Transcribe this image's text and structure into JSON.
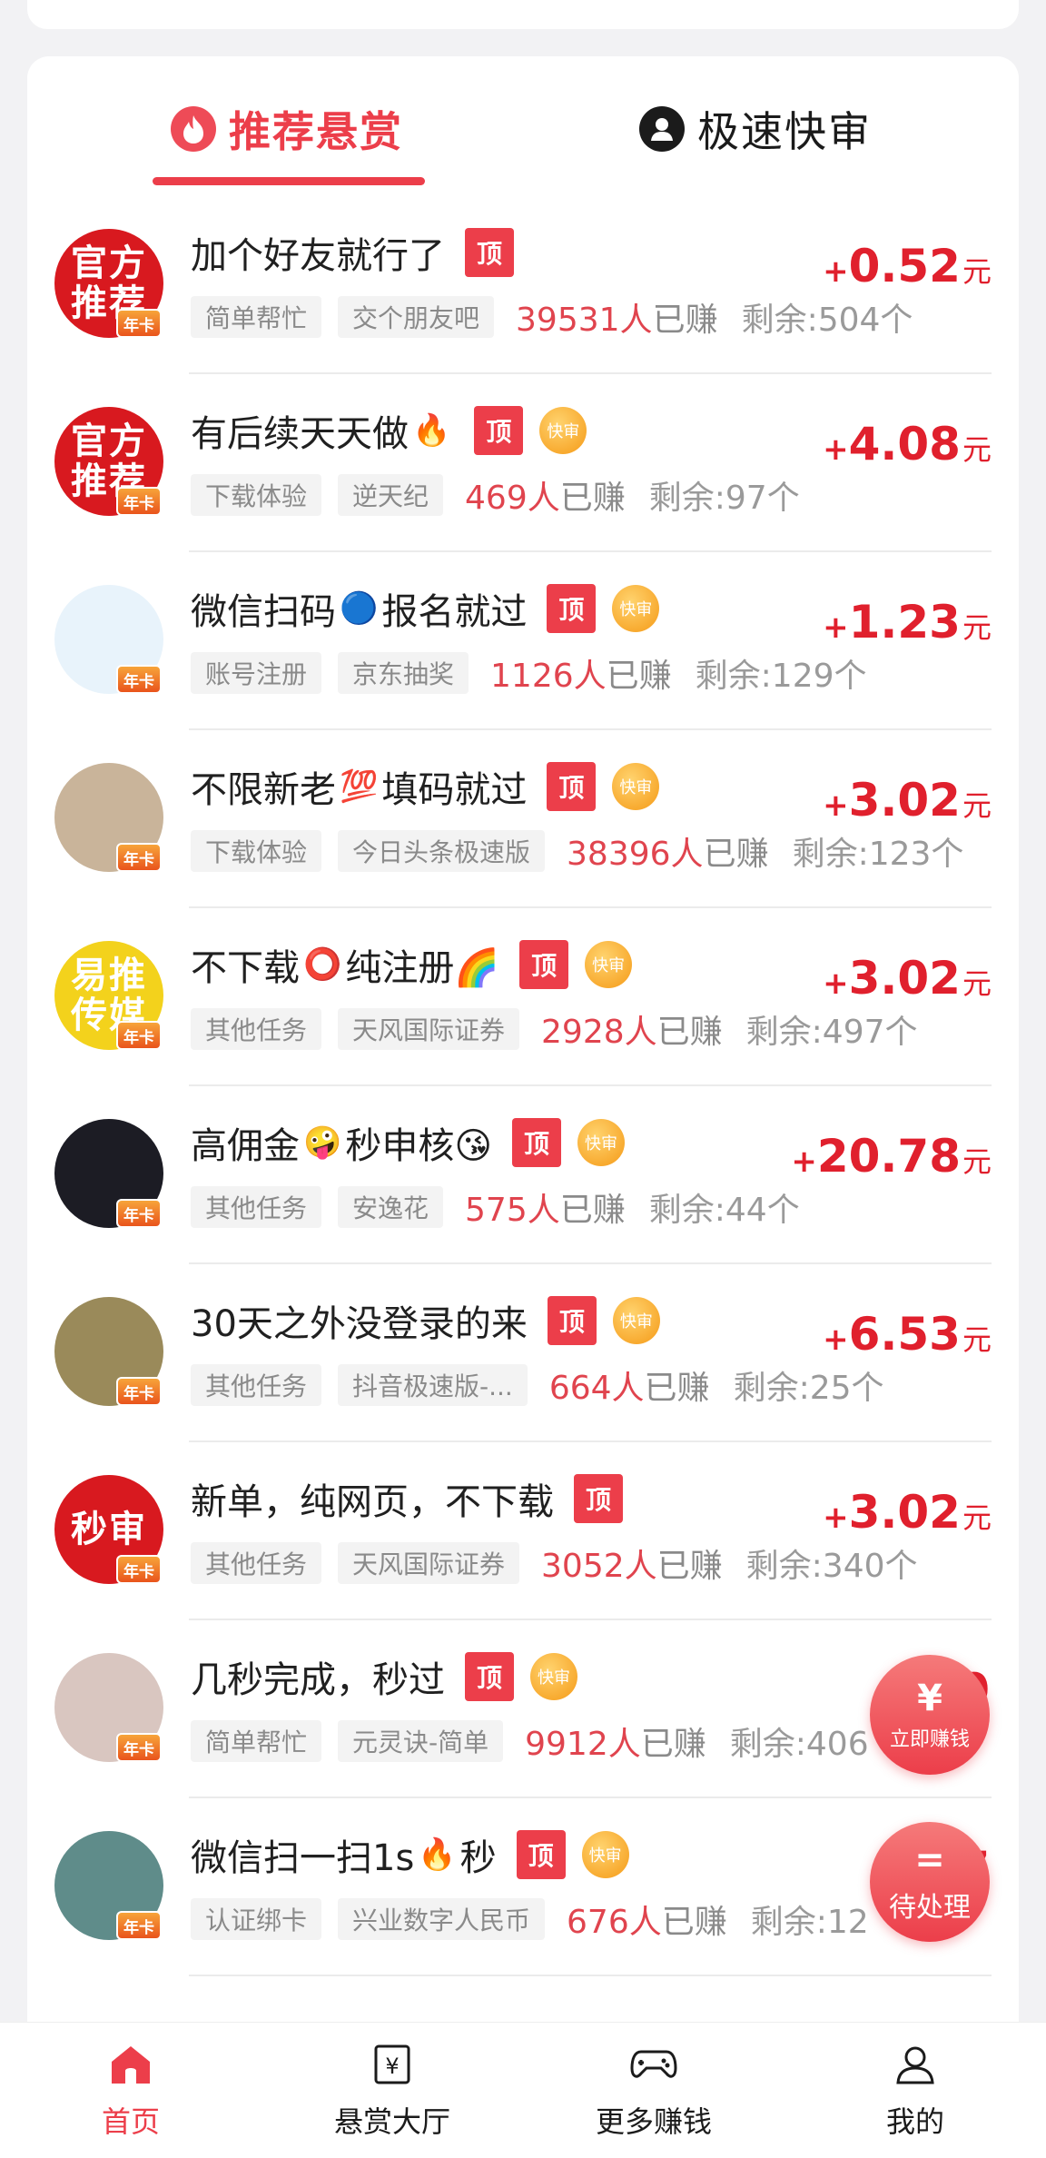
{
  "tabs": [
    {
      "label": "推荐悬赏",
      "icon": "flame-icon"
    },
    {
      "label": "极速快审",
      "icon": "user-circle-icon"
    }
  ],
  "badges": {
    "top": "顶",
    "fast": "快审",
    "vip": "年卡"
  },
  "tasks": [
    {
      "title": "加个好友就行了",
      "emoji": "",
      "title2": "",
      "tags": [
        "简单帮忙",
        "交个朋友吧"
      ],
      "earned_num": "39531人",
      "earned_suffix": "已赚",
      "remain": "剩余:504个",
      "price_plus": "+",
      "price": "0.52",
      "unit": "元",
      "top": true,
      "fast": false,
      "avatar_text": "官方推荐",
      "avatar_bg": "#d8191f"
    },
    {
      "title": "有后续天天做",
      "emoji": "🔥",
      "title2": "",
      "tags": [
        "下载体验",
        "逆天纪"
      ],
      "earned_num": "469人",
      "earned_suffix": "已赚",
      "remain": "剩余:97个",
      "price_plus": "+",
      "price": "4.08",
      "unit": "元",
      "top": true,
      "fast": true,
      "avatar_text": "官方推荐",
      "avatar_bg": "#d8191f"
    },
    {
      "title": "微信扫码",
      "emoji": "🔵",
      "title2": "报名就过",
      "tags": [
        "账号注册",
        "京东抽奖"
      ],
      "earned_num": "1126人",
      "earned_suffix": "已赚",
      "remain": "剩余:129个",
      "price_plus": "+",
      "price": "1.23",
      "unit": "元",
      "top": true,
      "fast": true,
      "avatar_text": "",
      "avatar_bg": "#e8f3fb"
    },
    {
      "title": "不限新老",
      "emoji": "💯",
      "title2": "填码就过",
      "tags": [
        "下载体验",
        "今日头条极速版"
      ],
      "earned_num": "38396人",
      "earned_suffix": "已赚",
      "remain": "剩余:123个",
      "price_plus": "+",
      "price": "3.02",
      "unit": "元",
      "top": true,
      "fast": true,
      "avatar_text": "",
      "avatar_bg": "#c9b49a"
    },
    {
      "title": "不下载",
      "emoji": "⭕",
      "title2": "纯注册🌈",
      "tags": [
        "其他任务",
        "天风国际证券"
      ],
      "earned_num": "2928人",
      "earned_suffix": "已赚",
      "remain": "剩余:497个",
      "price_plus": "+",
      "price": "3.02",
      "unit": "元",
      "top": true,
      "fast": true,
      "avatar_text": "易推传媒",
      "avatar_bg": "#f3d21c"
    },
    {
      "title": "高佣金",
      "emoji": "🤪",
      "title2": "秒申核😘",
      "tags": [
        "其他任务",
        "安逸花"
      ],
      "earned_num": "575人",
      "earned_suffix": "已赚",
      "remain": "剩余:44个",
      "price_plus": "+",
      "price": "20.78",
      "unit": "元",
      "top": true,
      "fast": true,
      "avatar_text": "",
      "avatar_bg": "#1c1c24"
    },
    {
      "title": "30天之外没登录的来",
      "emoji": "",
      "title2": "",
      "tags": [
        "其他任务",
        "抖音极速版-..."
      ],
      "earned_num": "664人",
      "earned_suffix": "已赚",
      "remain": "剩余:25个",
      "price_plus": "+",
      "price": "6.53",
      "unit": "元",
      "top": true,
      "fast": true,
      "avatar_text": "",
      "avatar_bg": "#9a8a5a"
    },
    {
      "title": "新单，纯网页，不下载",
      "emoji": "",
      "title2": "",
      "tags": [
        "其他任务",
        "天风国际证券"
      ],
      "earned_num": "3052人",
      "earned_suffix": "已赚",
      "remain": "剩余:340个",
      "price_plus": "+",
      "price": "3.02",
      "unit": "元",
      "top": true,
      "fast": false,
      "avatar_text": "秒审",
      "avatar_bg": "#d8191f"
    },
    {
      "title": "几秒完成，秒过",
      "emoji": "",
      "title2": "",
      "tags": [
        "简单帮忙",
        "元灵诀-简单"
      ],
      "earned_num": "9912人",
      "earned_suffix": "已赚",
      "remain": "剩余:406",
      "price_plus": "+",
      "price": "0",
      "unit": "",
      "top": true,
      "fast": true,
      "avatar_text": "",
      "avatar_bg": "#d9c6c0"
    },
    {
      "title": "微信扫一扫1s",
      "emoji": "🔥",
      "title2": "秒",
      "tags": [
        "认证绑卡",
        "兴业数字人民币"
      ],
      "earned_num": "676人",
      "earned_suffix": "已赚",
      "remain": "剩余:12",
      "price_plus": "+",
      "price": "7",
      "unit": "",
      "top": true,
      "fast": true,
      "avatar_text": "",
      "avatar_bg": "#5f8c8a"
    }
  ],
  "floats": {
    "earn_icon": "¥",
    "earn_label": "立即赚钱",
    "pending_icon": "=",
    "pending_label": "待处理"
  },
  "nav": [
    {
      "label": "首页",
      "icon": "home-icon"
    },
    {
      "label": "悬赏大厅",
      "icon": "bounty-icon"
    },
    {
      "label": "更多赚钱",
      "icon": "gamepad-icon"
    },
    {
      "label": "我的",
      "icon": "profile-icon"
    }
  ],
  "colors": {
    "accent": "#ec3e4a",
    "price": "#e0202d"
  }
}
